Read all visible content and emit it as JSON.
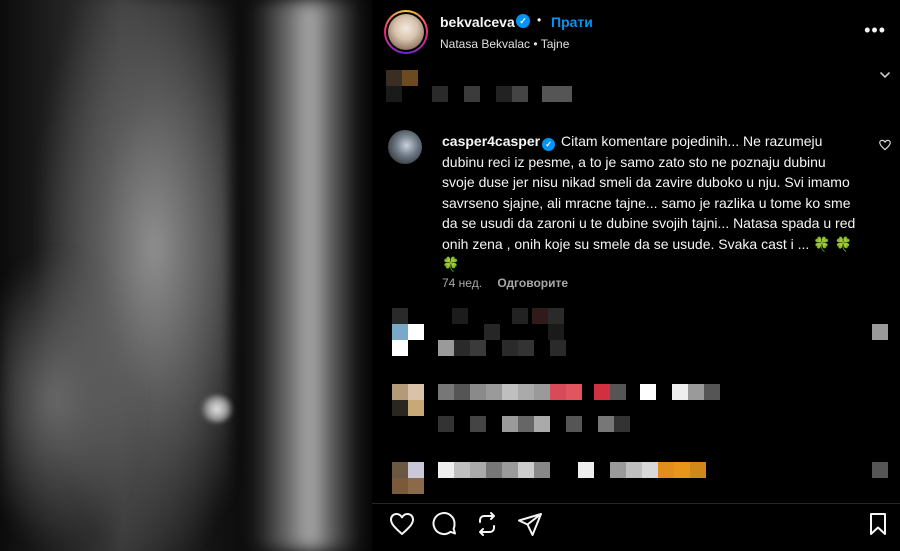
{
  "post": {
    "username": "bekvalceva",
    "dot": "•",
    "follow_label": "Прати",
    "subline": "Natasa Bekvalac • Tajne",
    "more_label": "•••"
  },
  "comment": {
    "username": "casper4casper",
    "text": "Citam komentare pojedinih... Ne razumeju dubinu reci iz pesme, a to je samo zato sto ne poznaju dubinu svoje duse jer nisu nikad smeli da zavire duboko u nju. Svi imamo savrseno sjajne, ali mracne tajne... samo je razlika u tome ko sme da se usudi da zaroni u te dubine svojih tajni... Natasa spada u red onih zena , onih koje su smele da se usude. Svaka cast i ...",
    "emoji": "🍀 🍀 🍀",
    "time": "74 нед.",
    "reply_label": "Одговорите"
  },
  "icons": {
    "verified": "verified-badge-icon",
    "heart": "heart-icon",
    "comment": "comment-icon",
    "repost": "repost-icon",
    "share": "share-icon",
    "save": "bookmark-icon",
    "expand": "chevron-down-icon"
  },
  "colors": {
    "accent": "#0095f6",
    "background": "#000000",
    "text": "#f5f5f5",
    "muted": "#a8a8a8"
  }
}
